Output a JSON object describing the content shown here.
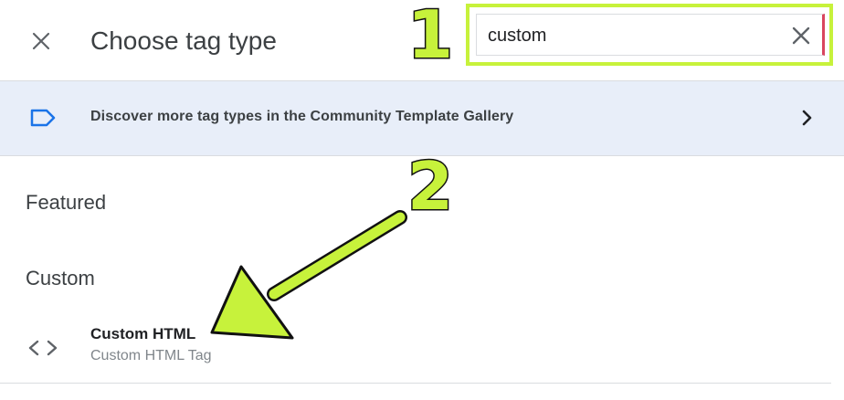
{
  "header": {
    "title": "Choose tag type",
    "close_icon": "close-icon"
  },
  "search": {
    "value": "custom",
    "clear_icon": "close-icon"
  },
  "annotations": {
    "step1": "1",
    "step2": "2",
    "highlight_color": "#c7f23b"
  },
  "banner": {
    "icon": "tag-icon",
    "text": "Discover more tag types in the Community Template Gallery",
    "chevron": "chevron-right-icon",
    "background": "#e8eef9",
    "icon_color": "#1a73e8"
  },
  "sections": {
    "featured": "Featured",
    "custom": "Custom"
  },
  "items": [
    {
      "icon": "code-icon",
      "title": "Custom HTML",
      "subtitle": "Custom HTML Tag"
    }
  ]
}
